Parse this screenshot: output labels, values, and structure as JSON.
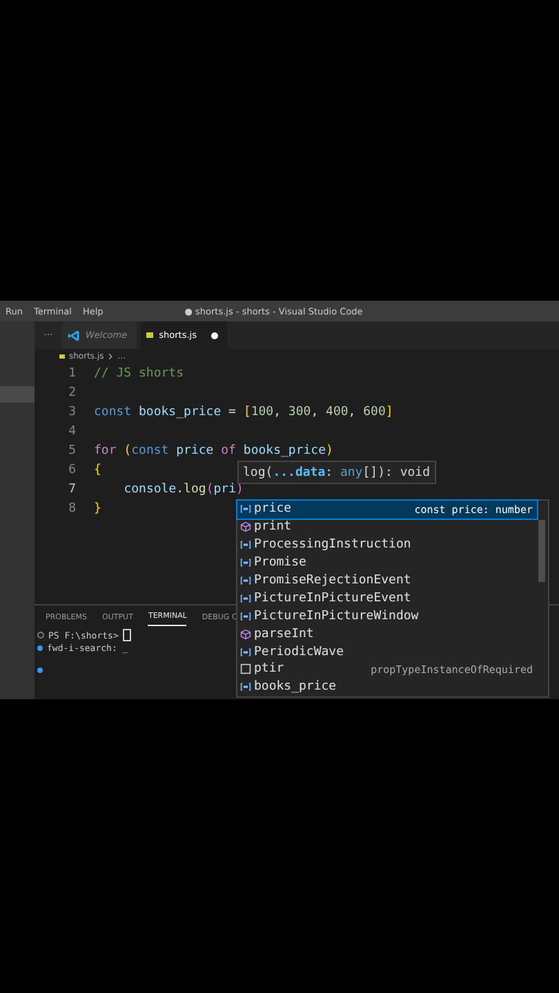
{
  "title_bar": {
    "menu": [
      "Run",
      "Terminal",
      "Help"
    ],
    "title": "● shorts.js - shorts - Visual Studio Code"
  },
  "tab_overflow": "···",
  "tabs": [
    {
      "label": "Welcome",
      "kind": "welcome",
      "selected": false,
      "modified": false
    },
    {
      "label": "shorts.js",
      "kind": "js",
      "selected": true,
      "modified": true
    }
  ],
  "breadcrumb": {
    "file": "shorts.js",
    "rest": "..."
  },
  "code_lines": [
    {
      "number": "1",
      "active": false,
      "tokens": [
        {
          "kind": "comment",
          "text": "// JS shorts"
        }
      ]
    },
    {
      "number": "2",
      "active": false
    },
    {
      "number": "3",
      "active": false,
      "tokens": [
        {
          "kind": "keyword",
          "text": "const"
        },
        {
          "kind": "variable",
          "text": " books_price"
        },
        {
          "kind": "plain",
          "text": " = "
        },
        {
          "kind": "bracket",
          "text": "["
        },
        {
          "kind": "number",
          "text": "100"
        },
        {
          "kind": "plain",
          "text": ", "
        },
        {
          "kind": "number",
          "text": "300"
        },
        {
          "kind": "plain",
          "text": ", "
        },
        {
          "kind": "number",
          "text": "400"
        },
        {
          "kind": "plain",
          "text": ", "
        },
        {
          "kind": "number",
          "text": "600"
        },
        {
          "kind": "bracket",
          "text": "]"
        }
      ]
    },
    {
      "number": "4",
      "active": false
    },
    {
      "number": "5",
      "active": false,
      "tokens": [
        {
          "kind": "control",
          "text": "for"
        },
        {
          "kind": "bracket",
          "text": " ("
        },
        {
          "kind": "keyword",
          "text": "const"
        },
        {
          "kind": "variable",
          "text": " price"
        },
        {
          "kind": "control",
          "text": " of"
        },
        {
          "kind": "variable",
          "text": " books_price"
        },
        {
          "kind": "bracket",
          "text": ")"
        }
      ]
    },
    {
      "number": "6",
      "active": false,
      "tokens": [
        {
          "kind": "bracket",
          "text": "{"
        }
      ]
    },
    {
      "number": "7",
      "active": true,
      "indented": true,
      "tokens": [
        {
          "kind": "variable",
          "text": "console"
        },
        {
          "kind": "plain",
          "text": "."
        },
        {
          "kind": "function",
          "text": "log"
        },
        {
          "kind": "bracket2",
          "text": "("
        },
        {
          "kind": "variable",
          "text": "pri"
        },
        {
          "kind": "bracket2",
          "text": ")"
        }
      ]
    },
    {
      "number": "8",
      "active": false,
      "tokens": [
        {
          "kind": "bracket",
          "text": "}"
        }
      ]
    }
  ],
  "signature_hint": [
    {
      "kind": "plain",
      "text": "log("
    },
    {
      "kind": "param",
      "text": "...data"
    },
    {
      "kind": "plain",
      "text": ": "
    },
    {
      "kind": "type",
      "text": "any"
    },
    {
      "kind": "plain",
      "text": "[]): void"
    }
  ],
  "suggestions": [
    {
      "kind": "variable",
      "label": "price",
      "detail": "const price: number",
      "selected": true
    },
    {
      "kind": "function",
      "label": "print",
      "selected": false
    },
    {
      "kind": "variable",
      "label": "ProcessingInstruction",
      "selected": false
    },
    {
      "kind": "variable",
      "label": "Promise",
      "selected": false
    },
    {
      "kind": "variable",
      "label": "PromiseRejectionEvent",
      "selected": false
    },
    {
      "kind": "variable",
      "label": "PictureInPictureEvent",
      "selected": false
    },
    {
      "kind": "variable",
      "label": "PictureInPictureWindow",
      "selected": false
    },
    {
      "kind": "function",
      "label": "parseInt",
      "selected": false
    },
    {
      "kind": "variable",
      "label": "PeriodicWave",
      "selected": false
    },
    {
      "kind": "snippet",
      "label": "ptir",
      "detail": "propTypeInstanceOfRequired",
      "selected": false
    },
    {
      "kind": "variable",
      "label": "books_price",
      "selected": false
    }
  ],
  "panel": {
    "tabs": [
      {
        "label": "PROBLEMS",
        "selected": false
      },
      {
        "label": "OUTPUT",
        "selected": false
      },
      {
        "label": "TERMINAL",
        "selected": true
      },
      {
        "label": "DEBUG C",
        "selected": false
      }
    ],
    "terminal_lines": [
      {
        "kind": "prompt",
        "text": "PS F:\\shorts>"
      },
      {
        "kind": "search",
        "text": "fwd-i-search: _"
      }
    ]
  }
}
